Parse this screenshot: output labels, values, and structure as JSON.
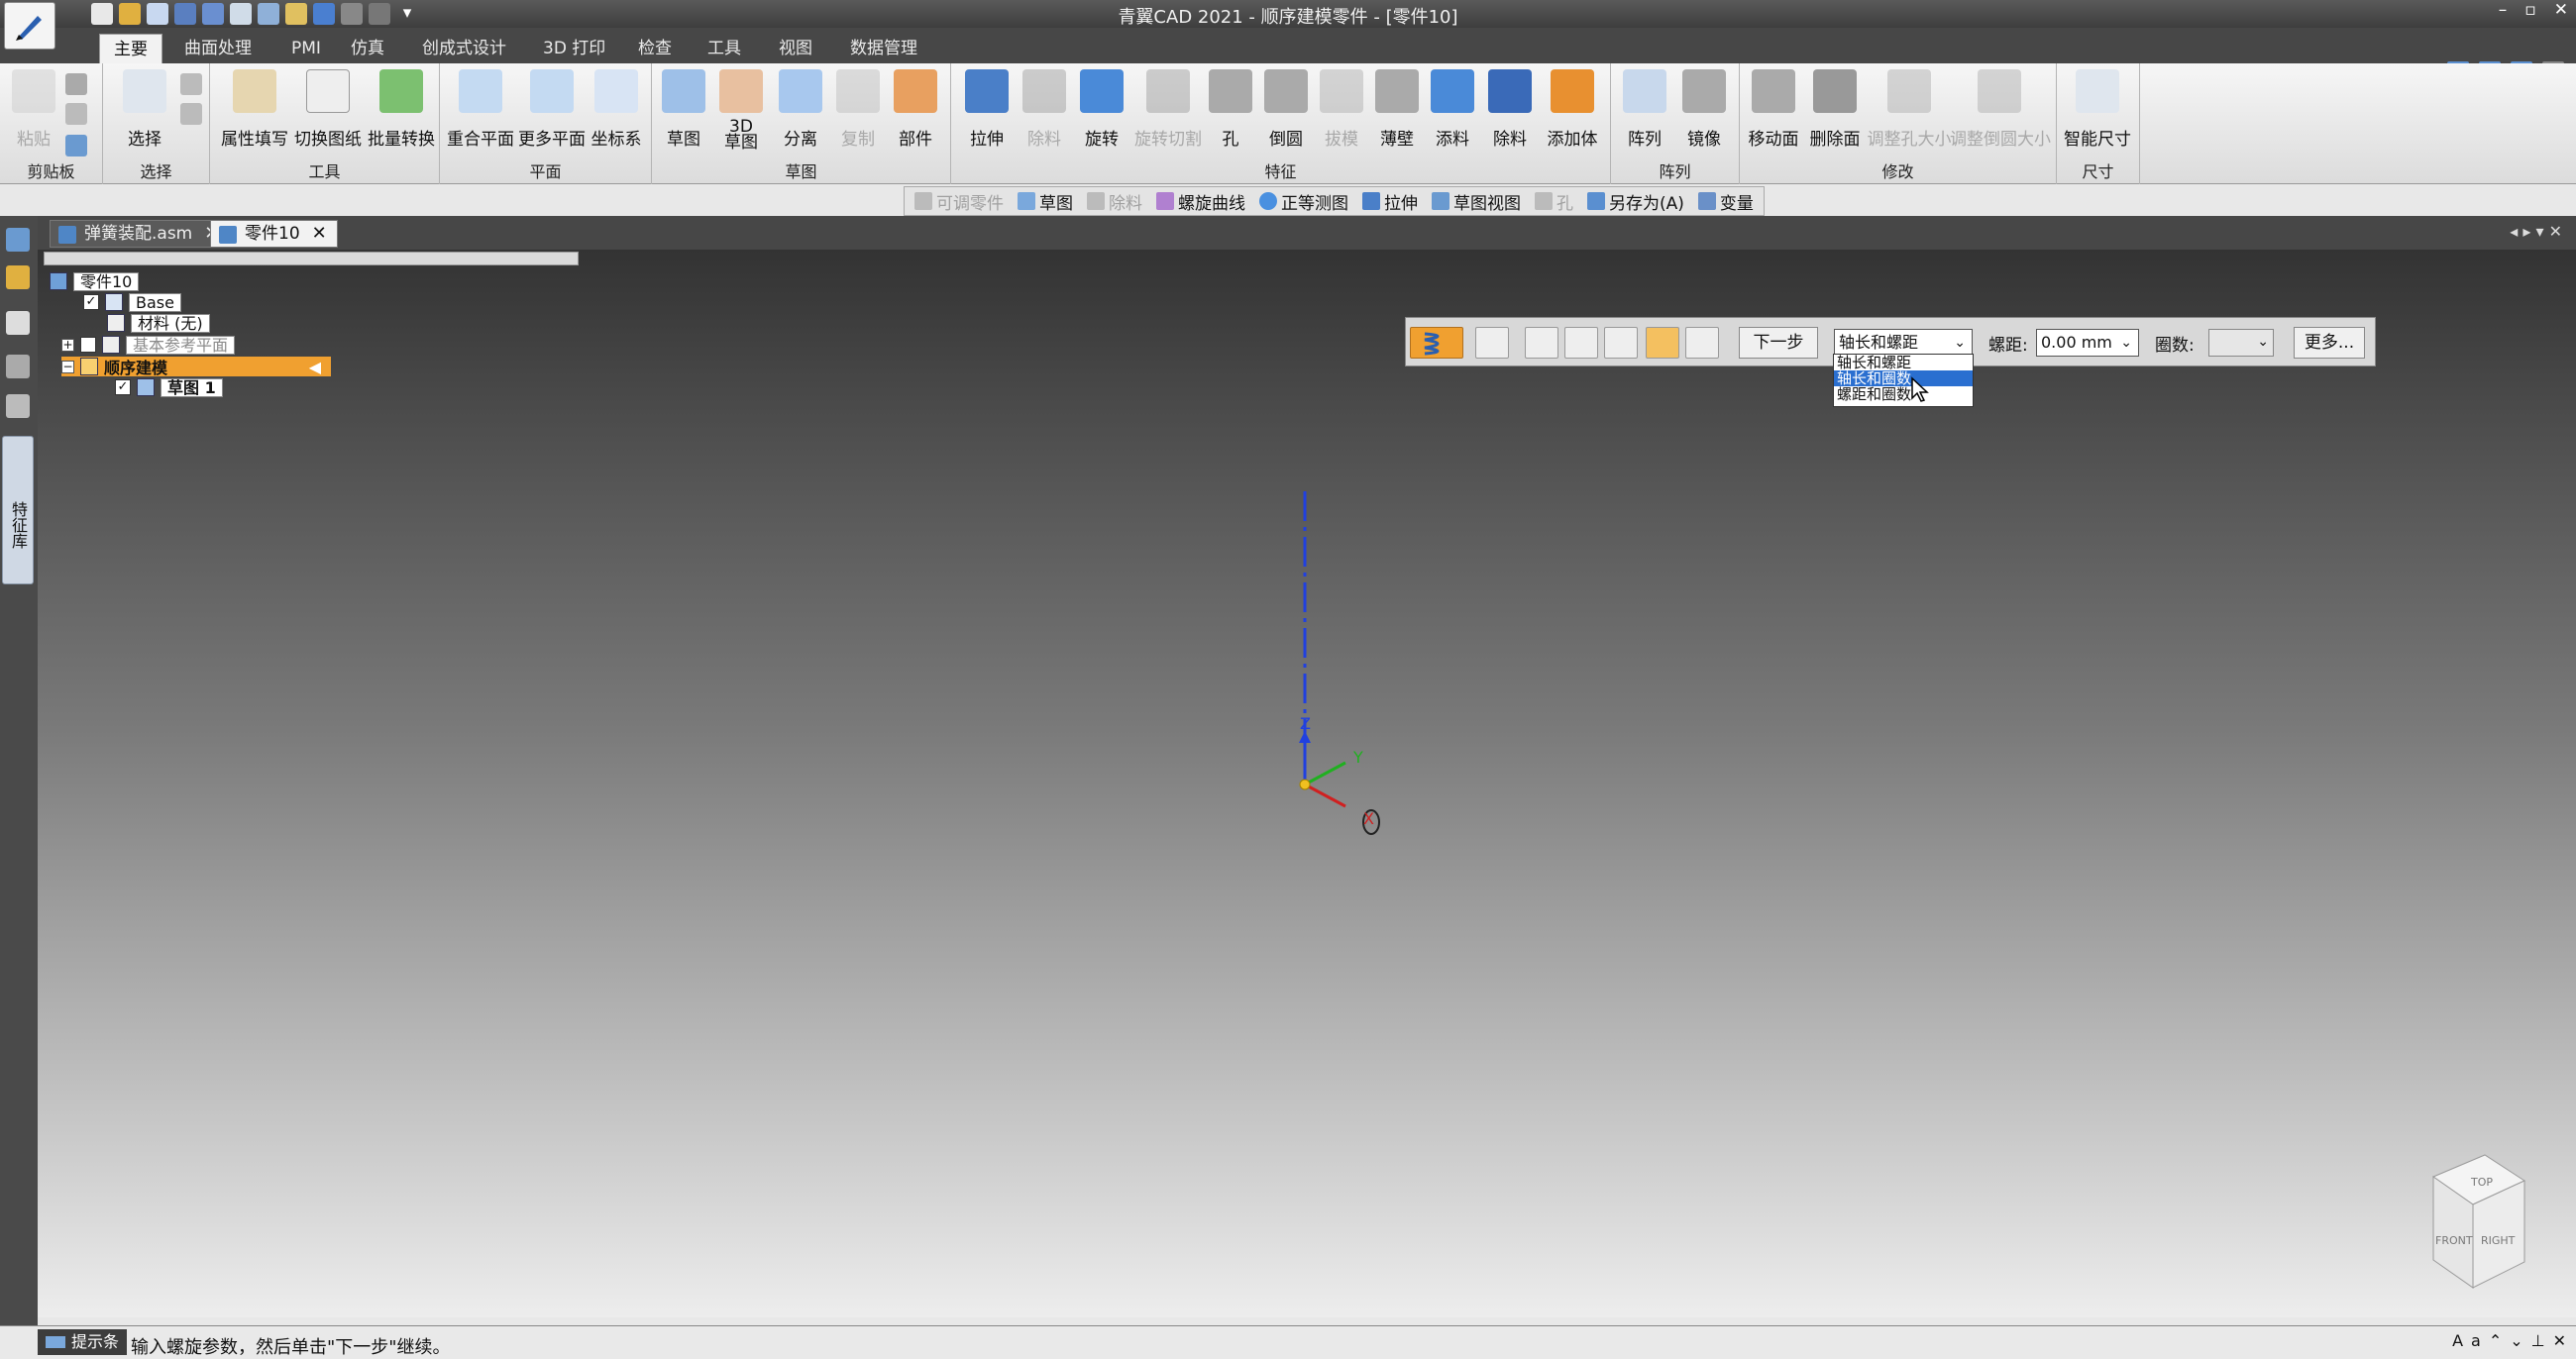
{
  "app": {
    "title": "青翼CAD 2021 - 顺序建模零件 - [零件10]",
    "window_controls": [
      "–",
      "▫",
      "✕"
    ]
  },
  "ribbon_tabs": [
    "主要",
    "曲面处理",
    "PMI",
    "仿真",
    "创成式设计",
    "3D 打印",
    "检查",
    "工具",
    "视图",
    "数据管理"
  ],
  "ribbon_groups": {
    "clipboard": {
      "label": "剪贴板",
      "paste": "粘贴"
    },
    "select": {
      "label": "选择",
      "select": "选择"
    },
    "tools": {
      "label": "工具",
      "attr_fill": "属性填写",
      "switch_drawing": "切换图纸",
      "batch_convert": "批量转换"
    },
    "plane": {
      "label": "平面",
      "coincident_plane": "重合平面",
      "more_planes": "更多平面",
      "coord_sys": "坐标系"
    },
    "sketch": {
      "label": "草图",
      "sketch": "草图",
      "sketch3d": "3D\n草图",
      "split": "分离",
      "copy": "复制",
      "part": "部件"
    },
    "feature": {
      "label": "特征",
      "extrude": "拉伸",
      "cut": "除料",
      "revolve": "旋转",
      "revolve_cut": "旋转切割",
      "hole": "孔",
      "round": "倒圆",
      "draft": "拔模",
      "thin_wall": "薄壁",
      "add_material": "添料",
      "remove_material": "除料",
      "add_body": "添加体"
    },
    "pattern": {
      "label": "阵列",
      "pattern": "阵列",
      "mirror": "镜像"
    },
    "modify": {
      "label": "修改",
      "move_face": "移动面",
      "delete_face": "删除面",
      "resize_hole": "调整孔大小",
      "resize_round": "调整倒圆大小"
    },
    "dimension": {
      "label": "尺寸",
      "smart_dim": "智能尺寸"
    }
  },
  "command_toolbar": [
    {
      "label": "可调零件",
      "enabled": false
    },
    {
      "label": "草图",
      "enabled": true
    },
    {
      "label": "除料",
      "enabled": false
    },
    {
      "label": "螺旋曲线",
      "enabled": true
    },
    {
      "label": "正等测图",
      "enabled": true
    },
    {
      "label": "拉伸",
      "enabled": true
    },
    {
      "label": "草图视图",
      "enabled": true
    },
    {
      "label": "孔",
      "enabled": false
    },
    {
      "label": "另存为(A)",
      "enabled": true
    },
    {
      "label": "变量",
      "enabled": true
    }
  ],
  "left_panel": {
    "label": "特征库"
  },
  "doc_tabs": [
    {
      "label": "弹簧装配.asm",
      "active": false
    },
    {
      "label": "零件10",
      "active": true
    }
  ],
  "tree": {
    "root": "零件10",
    "base": "Base",
    "material": "材料 (无)",
    "ref_planes": "基本参考平面",
    "sequential": "顺序建模",
    "sketch1": "草图 1"
  },
  "helix_bar": {
    "next_label": "下一步",
    "mode_value": "轴长和螺距",
    "mode_options": [
      "轴长和螺距",
      "轴长和圈数",
      "螺距和圈数"
    ],
    "mode_highlighted_index": 1,
    "pitch_label": "螺距:",
    "pitch_value": "0.00 mm",
    "turns_label": "圈数:",
    "turns_value": "",
    "more_label": "更多..."
  },
  "axes": {
    "z": "Z",
    "y": "Y",
    "x": "X"
  },
  "view_cube": {
    "top": "TOP",
    "front": "FRONT",
    "right": "RIGHT"
  },
  "status": {
    "prompt_tab": "提示条",
    "prompt_text": "输入螺旋参数，然后单击\"下一步\"继续。"
  },
  "colors": {
    "accent": "#f0a030",
    "axis_z": "#2040e0",
    "axis_y": "#20b020",
    "axis_x": "#d02020"
  }
}
